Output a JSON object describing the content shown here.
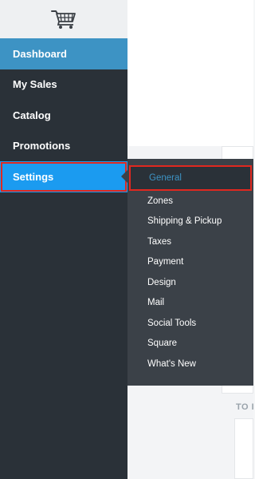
{
  "sidebar": {
    "logo_icon": "shopping-cart-icon",
    "items": [
      {
        "label": "Dashboard"
      },
      {
        "label": "My Sales"
      },
      {
        "label": "Catalog"
      },
      {
        "label": "Promotions"
      },
      {
        "label": "Settings"
      }
    ]
  },
  "submenu": {
    "items": [
      {
        "label": "General"
      },
      {
        "label": "Zones"
      },
      {
        "label": "Shipping & Pickup"
      },
      {
        "label": "Taxes"
      },
      {
        "label": "Payment"
      },
      {
        "label": "Design"
      },
      {
        "label": "Mail"
      },
      {
        "label": "Social Tools"
      },
      {
        "label": "Square"
      },
      {
        "label": "What's New"
      }
    ]
  },
  "main": {
    "section_label": "TO I"
  },
  "colors": {
    "sidebar_bg": "#2a3138",
    "dashboard_bg": "#3d93c4",
    "settings_bg": "#1b9bf0",
    "submenu_bg": "#3b4148",
    "highlight_border": "#e0281f",
    "active_text": "#3d93c4"
  }
}
